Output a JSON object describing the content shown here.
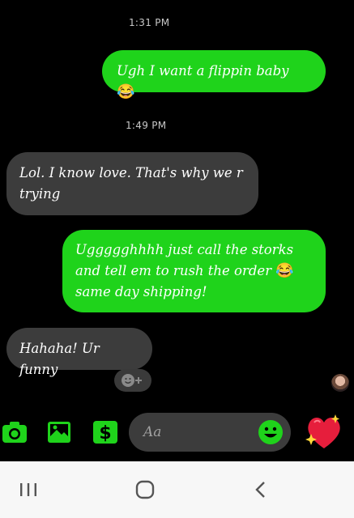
{
  "conversation": {
    "messages": [
      {
        "type": "timestamp",
        "text": "1:31 PM"
      },
      {
        "type": "sent",
        "text": "Ugh I want a flippin baby",
        "emoji": "😂"
      },
      {
        "type": "timestamp",
        "text": "1:49 PM"
      },
      {
        "type": "received",
        "line1": "Lol. I know love. That's why we r",
        "line2": "trying"
      },
      {
        "type": "sent",
        "line1": "Uggggghhhh just call the storks",
        "line2": "and tell em to rush the order",
        "emoji": "😂",
        "line3": "same day shipping!"
      },
      {
        "type": "received",
        "text": "Hahaha! Ur funny"
      }
    ]
  },
  "composer": {
    "placeholder": "Aa",
    "icons": [
      "camera-icon",
      "image-icon",
      "payment-dollar-icon",
      "emoji-smiley-icon",
      "heart-sparkle-icon"
    ]
  },
  "colors": {
    "background": "#000000",
    "sent_bubble": "#1fd31b",
    "received_bubble": "#3c3c3c",
    "accent": "#1fd31b"
  },
  "navbar": {
    "icons": [
      "recent-apps-icon",
      "home-icon",
      "back-icon"
    ]
  }
}
